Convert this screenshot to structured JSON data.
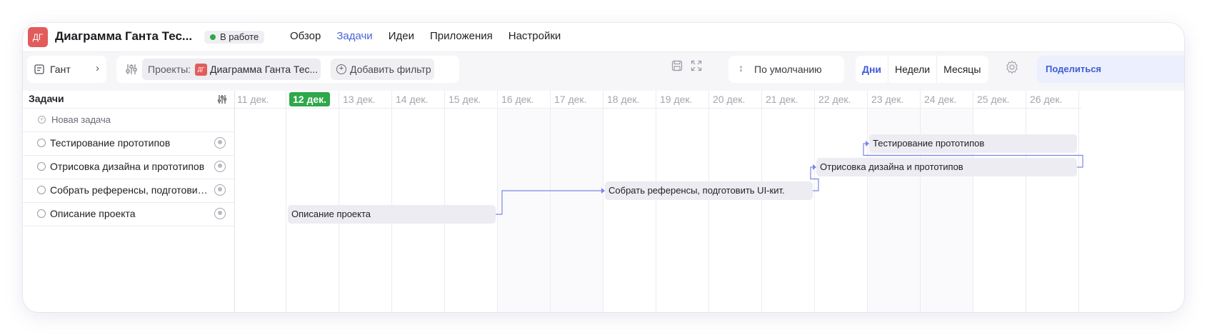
{
  "header": {
    "avatar": "ДГ",
    "title": "Диаграмма Ганта Тес...",
    "status": "В работе",
    "status_color": "#2ea84a",
    "nav": [
      "Обзор",
      "Задачи",
      "Идеи",
      "Приложения",
      "Настройки"
    ],
    "nav_active": "Задачи"
  },
  "toolbar": {
    "view_label": "Гант",
    "filter": {
      "project_label": "Проекты:",
      "project_avatar": "ДГ",
      "project_value": "Диаграмма Ганта Тес...",
      "add_filter": "Добавить фильтр"
    },
    "sort_label": "По умолчанию",
    "scale": [
      "Дни",
      "Недели",
      "Месяцы"
    ],
    "scale_active": "Дни",
    "share_label": "Поделиться"
  },
  "tasklist": {
    "title": "Задачи",
    "new_task": "Новая задача",
    "tasks": [
      "Тестирование прототипов",
      "Отрисовка дизайна и прототипов",
      "Собрать референсы, подготовить UI-кит.",
      "Описание проекта"
    ]
  },
  "timeline": {
    "dates": [
      "11 дек.",
      "12 дек.",
      "13 дек.",
      "14 дек.",
      "15 дек.",
      "16 дек.",
      "17 дек.",
      "18 дек.",
      "19 дек.",
      "20 дек.",
      "21 дек.",
      "22 дек.",
      "23 дек.",
      "24 дек.",
      "25 дек.",
      "26 дек."
    ],
    "today": "12 дек.",
    "weekend_days": [
      "16 дек.",
      "17 дек.",
      "23 дек.",
      "24 дек."
    ],
    "bars": [
      {
        "label": "Тестирование прототипов",
        "start": "23 дек.",
        "end": "26 дек.",
        "row": 0
      },
      {
        "label": "Отрисовка дизайна и прототипов",
        "start": "22 дек.",
        "end": "26 дек.",
        "row": 1
      },
      {
        "label": "Собрать референсы, подготовить UI-кит.",
        "start": "18 дек.",
        "end": "21 дек.",
        "row": 2
      },
      {
        "label": "Описание проекта",
        "start": "12 дек.",
        "end": "15 дек.",
        "row": 3
      }
    ],
    "link_color": "#7b86e6",
    "today_color": "#2ea84a"
  }
}
